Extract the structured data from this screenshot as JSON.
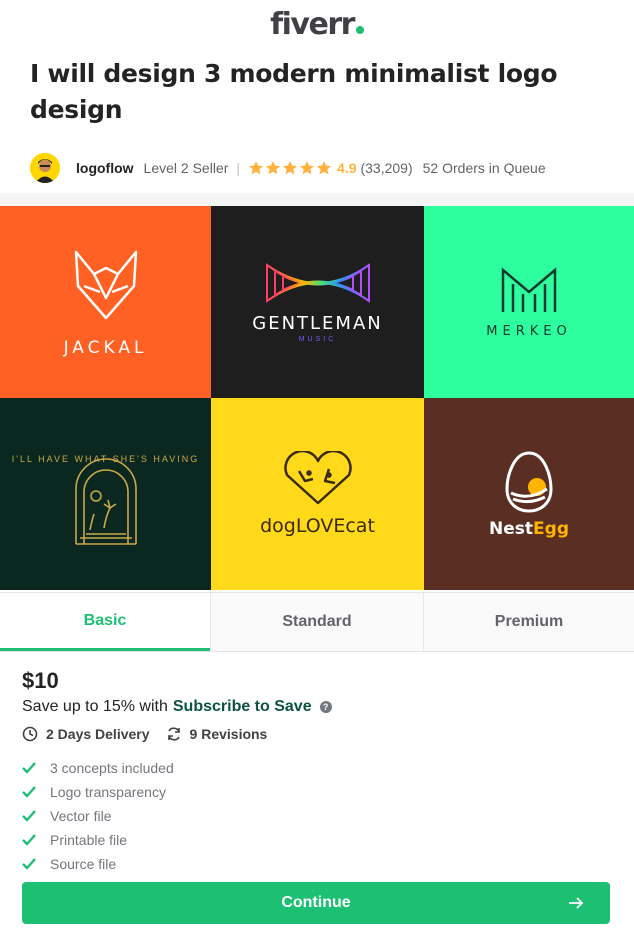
{
  "brand": {
    "name": "fiverr",
    "accent": "#1dbf73"
  },
  "gig": {
    "title": "I will design 3 modern minimalist logo design",
    "seller": {
      "name": "logoflow",
      "level": "Level 2 Seller",
      "rating": "4.9",
      "rating_stars": 5,
      "reviews": "(33,209)",
      "queue": "52 Orders in Queue"
    }
  },
  "gallery": {
    "tiles": [
      {
        "name": "jackal",
        "bg": "#ff6124",
        "text": "JACKAL"
      },
      {
        "name": "gentleman",
        "bg": "#1e1e1e",
        "text": "GENTLEMAN",
        "subtext": "MUSIC"
      },
      {
        "name": "merkeo",
        "bg": "#2eff9e",
        "text": "MERKEO"
      },
      {
        "name": "having",
        "bg": "#0b2820",
        "text": "I'LL HAVE WHAT SHE'S HAVING"
      },
      {
        "name": "doglovecat",
        "bg": "#ffd91a",
        "text": "dogLOVEcat"
      },
      {
        "name": "nestegg",
        "bg": "#5a2e22",
        "text_a": "Nest",
        "text_b": "Egg"
      }
    ]
  },
  "tabs": [
    {
      "label": "Basic",
      "active": true
    },
    {
      "label": "Standard",
      "active": false
    },
    {
      "label": "Premium",
      "active": false
    }
  ],
  "package": {
    "price": "$10",
    "save_text": "Save up to 15% with",
    "save_link": "Subscribe to Save",
    "help_icon": "?",
    "delivery": "2 Days Delivery",
    "revisions": "9 Revisions",
    "features": [
      "3 concepts included",
      "Logo transparency",
      "Vector file",
      "Printable file",
      "Source file"
    ]
  },
  "cta": {
    "label": "Continue"
  }
}
